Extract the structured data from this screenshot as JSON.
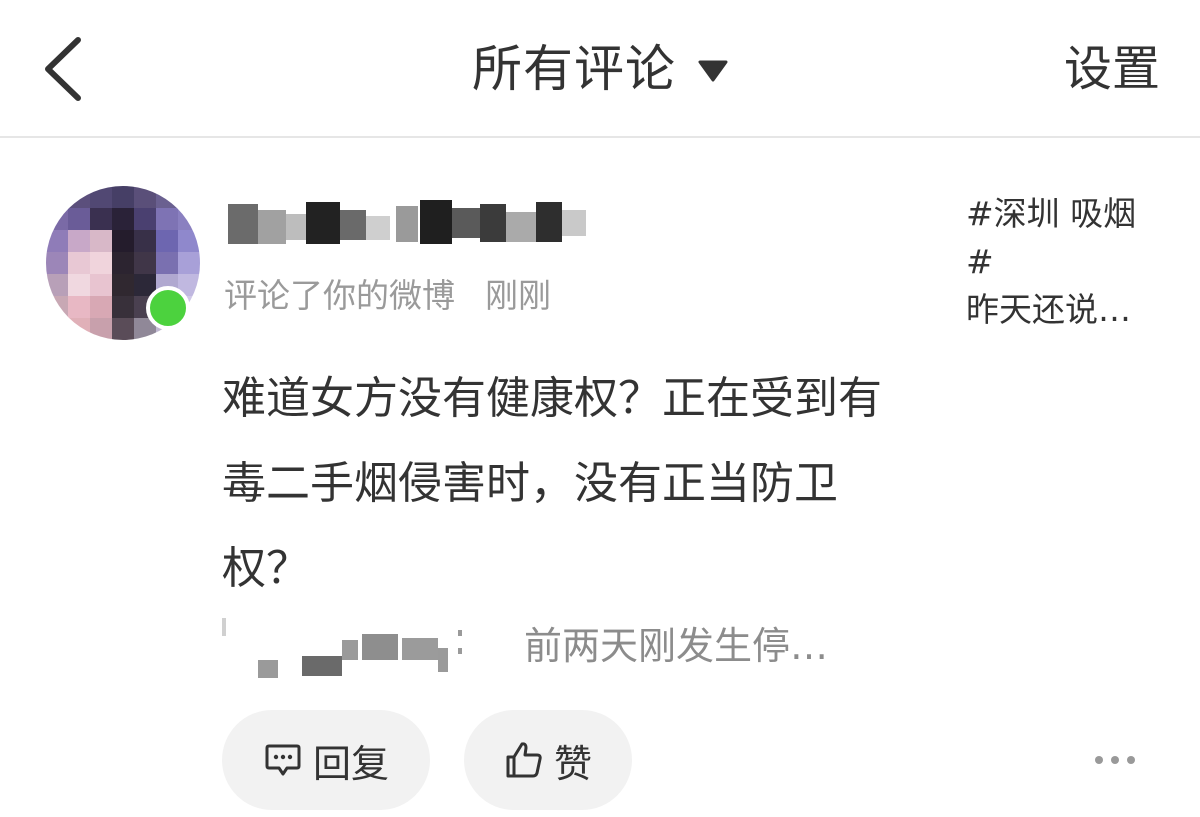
{
  "header": {
    "title": "所有评论",
    "settings_label": "设置",
    "icons": {
      "back": "chevron-left-icon",
      "dropdown": "caret-down-icon"
    }
  },
  "notification": {
    "action_text": "评论了你的微博",
    "time": "刚刚",
    "comment_text": "难道女方没有健康权？正在受到有毒二手烟侵害时，没有正当防卫权？",
    "quote_snippet": "前两天刚发生停…",
    "post_preview": {
      "line1": "#深圳 吸烟",
      "line2": "#",
      "line3": "昨天还说…"
    },
    "status_color": "#4cd23e"
  },
  "actions": {
    "reply_label": "回复",
    "like_label": "赞",
    "icons": {
      "reply": "comment-icon",
      "like": "thumbs-up-icon",
      "more": "more-icon"
    }
  }
}
